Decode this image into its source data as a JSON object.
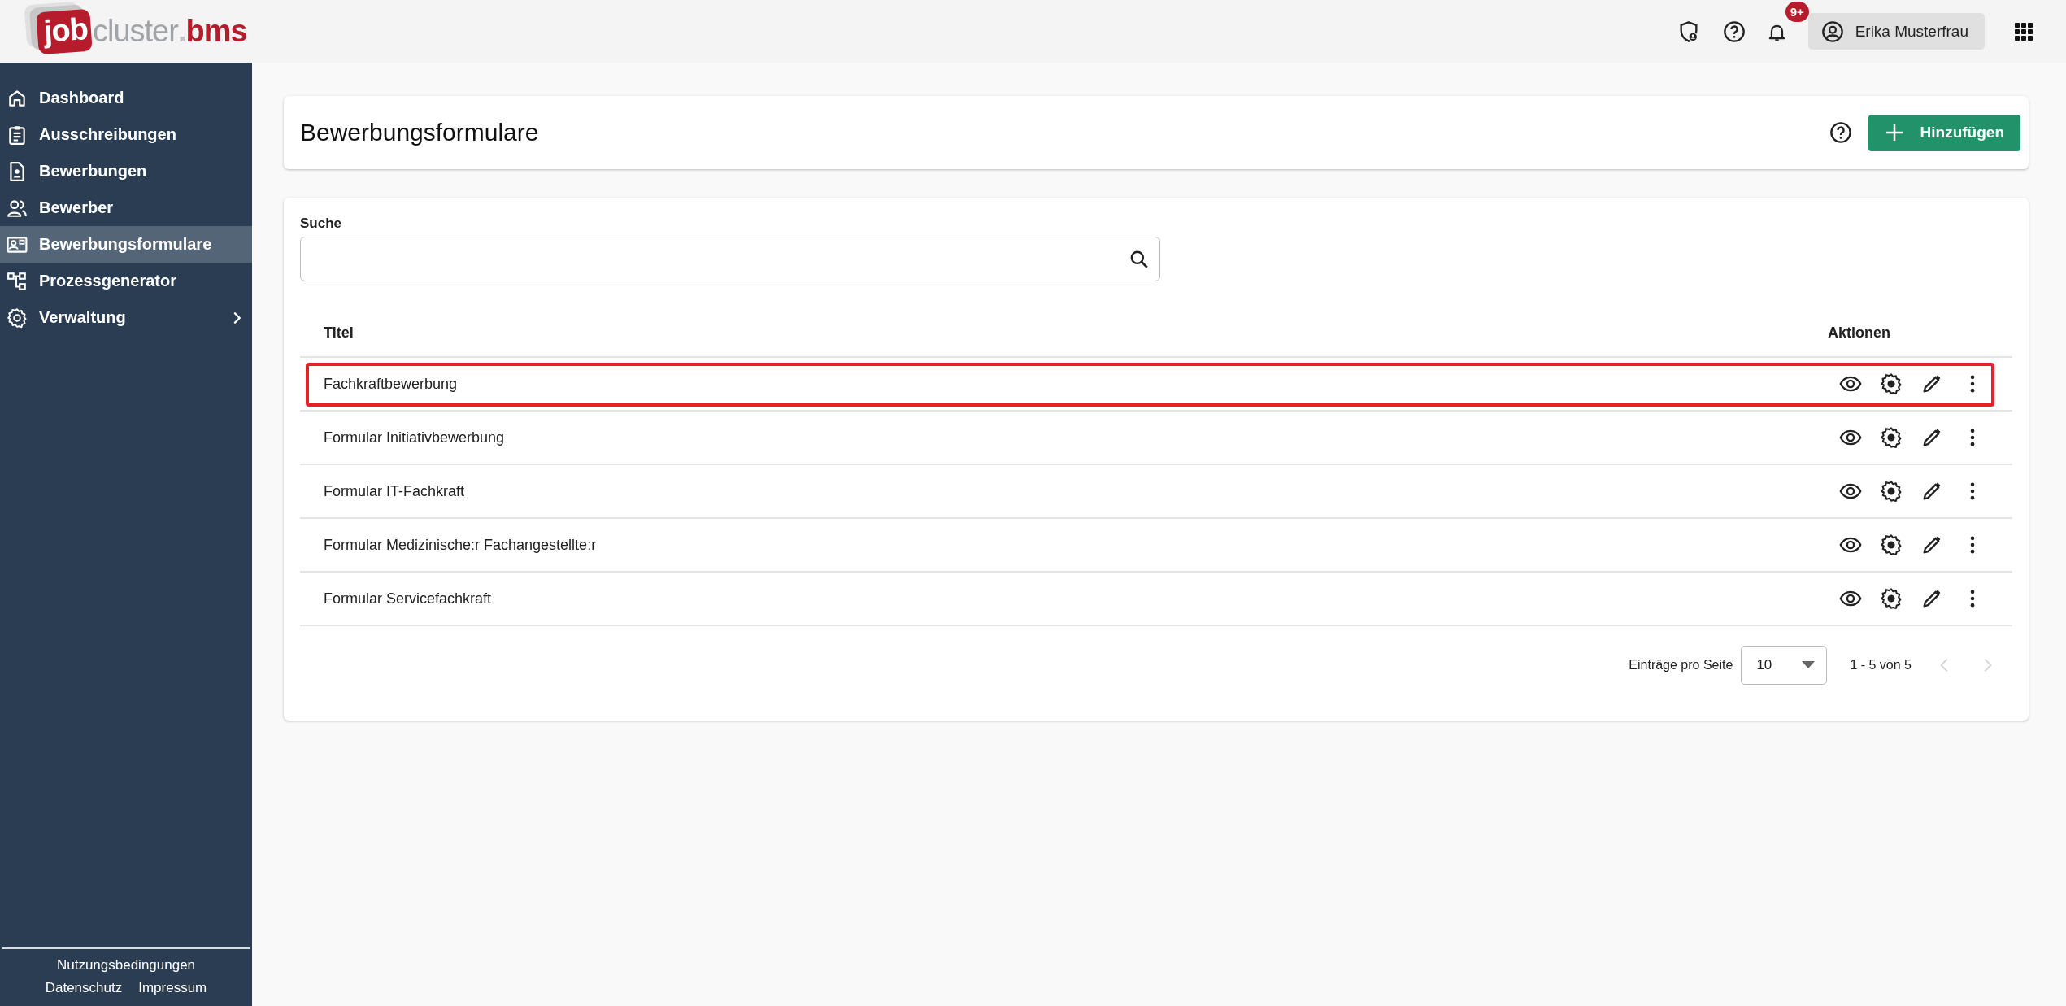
{
  "logo": {
    "badge": "job",
    "word": "cluster",
    "dot": ".",
    "suffix": "bms"
  },
  "header": {
    "notifications": {
      "badge": "9+"
    },
    "user": {
      "name": "Erika Musterfrau"
    }
  },
  "sidebar": {
    "items": [
      {
        "label": "Dashboard",
        "selected": false,
        "expandable": false
      },
      {
        "label": "Ausschreibungen",
        "selected": false,
        "expandable": false
      },
      {
        "label": "Bewerbungen",
        "selected": false,
        "expandable": false
      },
      {
        "label": "Bewerber",
        "selected": false,
        "expandable": false
      },
      {
        "label": "Bewerbungsformulare",
        "selected": true,
        "expandable": false
      },
      {
        "label": "Prozessgenerator",
        "selected": false,
        "expandable": false
      },
      {
        "label": "Verwaltung",
        "selected": false,
        "expandable": true
      }
    ],
    "footer": [
      "Nutzungsbedingungen",
      "Datenschutz",
      "Impressum"
    ]
  },
  "page": {
    "title": "Bewerbungsformulare",
    "add_button": "Hinzufügen"
  },
  "search": {
    "label": "Suche"
  },
  "table": {
    "columns": [
      "Titel",
      "Aktionen"
    ],
    "rows": [
      {
        "title": "Fachkraftbewerbung",
        "highlighted": true
      },
      {
        "title": "Formular Initiativbewerbung",
        "highlighted": false
      },
      {
        "title": "Formular IT-Fachkraft",
        "highlighted": false
      },
      {
        "title": "Formular Medizinische:r Fachangestellte:r",
        "highlighted": false
      },
      {
        "title": "Formular Servicefachkraft",
        "highlighted": false
      }
    ]
  },
  "pagination": {
    "label": "Einträge pro Seite",
    "page_size": "10",
    "range": "1 - 5 von 5",
    "prev_disabled": true,
    "next_disabled": true
  }
}
